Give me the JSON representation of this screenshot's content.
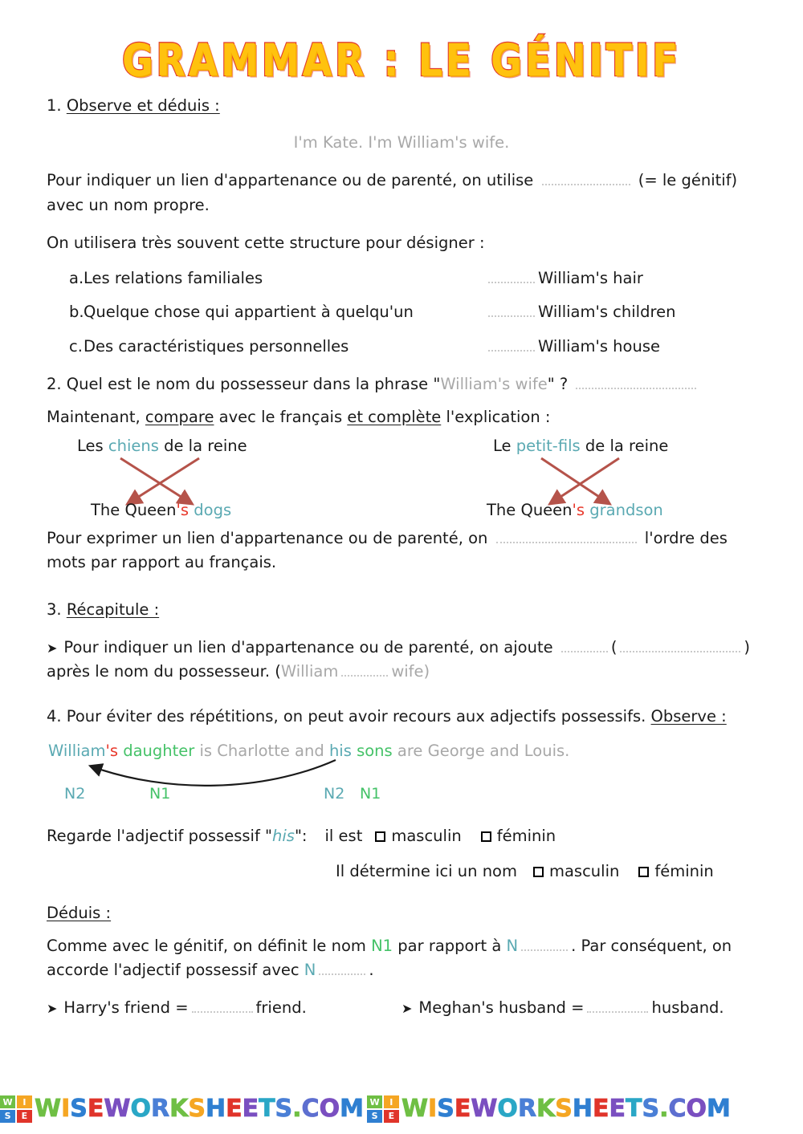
{
  "title": "GRAMMAR : LE GÉNITIF",
  "section1": {
    "heading_number": "1.",
    "heading": "Observe et déduis :",
    "example": "I'm Kate. I'm William's wife.",
    "rule_part1": "Pour indiquer un lien d'appartenance ou de parenté, on utilise",
    "rule_part2": "(= le génitif) avec un nom propre.",
    "intro_list": "On utilisera très souvent cette structure pour désigner :",
    "items": [
      {
        "mark": "a.",
        "french": "Les relations familiales",
        "english": "William's hair"
      },
      {
        "mark": "b.",
        "french": "Quelque chose qui appartient à quelqu'un",
        "english": "William's children"
      },
      {
        "mark": "c.",
        "french": "Des caractéristiques personnelles",
        "english": "William's house"
      }
    ]
  },
  "section2": {
    "question_part1": "2. Quel est le nom du possesseur dans la phrase \"",
    "question_quoted": "William's wife",
    "question_part2": "\" ?",
    "instruction_a": "Maintenant, ",
    "instruction_b": "compare",
    "instruction_c": " avec le français ",
    "instruction_d": "et complète",
    "instruction_e": " l'explication :",
    "diagram_left": {
      "fr_before": "Les ",
      "fr_highlight": "chiens",
      "fr_after": " de la reine",
      "en_before": "The Queen",
      "en_apostrophe": "'s",
      "en_after": " dogs"
    },
    "diagram_right": {
      "fr_before": "Le ",
      "fr_highlight": "petit-fils",
      "fr_after": " de la reine",
      "en_before": "The Queen",
      "en_apostrophe": "'s",
      "en_after": " grandson"
    },
    "conclusion_part1": "Pour exprimer un lien d'appartenance ou de parenté, on",
    "conclusion_part2": "l'ordre des mots par rapport au français."
  },
  "section3": {
    "heading_number": "3.",
    "heading": "Récapitule :",
    "bullet_part1": "Pour indiquer un lien d'appartenance ou de parenté, on ajoute",
    "bullet_open_paren": "(",
    "bullet_close_paren": ")",
    "bullet_part2": "après le nom du possesseur. (",
    "example_word1": "William",
    "example_word2": "wife",
    "bullet_part3": ")"
  },
  "section4": {
    "intro_part1": "4. Pour éviter des répétitions, on peut avoir recours aux adjectifs possessifs. ",
    "intro_underlined": "Observe :",
    "sentence": {
      "w1": "William",
      "apos": "'s",
      "w2": " daughter",
      "w3": " is Charlotte and ",
      "w4": "his",
      "w5": " sons",
      "w6": " are George and Louis."
    },
    "labels": {
      "n2a": "N2",
      "n1a": "N1",
      "n2b": "N2",
      "n1b": "N1"
    },
    "check_line1_lead": "Regarde l'adjectif possessif \"",
    "check_line1_word": "his",
    "check_line1_tail": "\":",
    "check_line1_prompt": "il est",
    "check_line2_prompt": "Il détermine ici un nom",
    "opt_masculine": "masculin",
    "opt_feminine": "féminin"
  },
  "deduis": {
    "heading": "Déduis :",
    "text_part1": "Comme avec le génitif, on définit le nom ",
    "text_n1": "N1",
    "text_part2": " par rapport à ",
    "text_n": "N",
    "text_part3": ". Par conséquent, on accorde l'adjectif possessif avec ",
    "text_n_b": "N",
    "text_part4": ".",
    "bullets": [
      {
        "left": "Harry's friend =",
        "right": "friend."
      },
      {
        "left": "Meghan's husband =",
        "right": "husband."
      }
    ]
  },
  "footer": {
    "logo_letters": [
      "W",
      "I",
      "S",
      "E"
    ],
    "brand": "WISEWORKSHEETS.COM",
    "repeat": 2
  },
  "colors": {
    "title_fill": "#FFC20E",
    "title_stroke": "#E03A2F",
    "teal": "#5aa9b2",
    "green": "#45c268",
    "red": "#e8392c",
    "gray": "#a8a8a8",
    "arrow_red": "#b5534a"
  }
}
